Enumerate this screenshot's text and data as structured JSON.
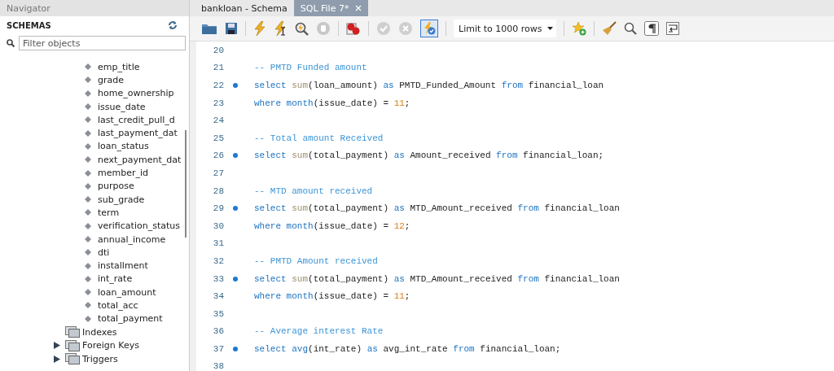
{
  "navigator": {
    "title": "Navigator",
    "section": "SCHEMAS",
    "filter": {
      "placeholder": "Filter objects"
    },
    "columns": [
      "emp_title",
      "grade",
      "home_ownership",
      "issue_date",
      "last_credit_pull_d",
      "last_payment_dat",
      "loan_status",
      "next_payment_dat",
      "member_id",
      "purpose",
      "sub_grade",
      "term",
      "verification_status",
      "annual_income",
      "dti",
      "installment",
      "int_rate",
      "loan_amount",
      "total_acc",
      "total_payment"
    ],
    "folders": [
      {
        "label": "Indexes"
      },
      {
        "label": "Foreign Keys",
        "expanded": false
      },
      {
        "label": "Triggers",
        "expanded": false
      }
    ]
  },
  "tabs": [
    {
      "label": "bankloan - Schema",
      "selected": false
    },
    {
      "label": "SQL File 7*",
      "selected": true
    }
  ],
  "toolbar": {
    "commit_disabled": true,
    "rollback_disabled": true,
    "autocommit_on": true,
    "limit": "Limit to 1000 rows"
  },
  "editor": {
    "lines": [
      {
        "number": "20",
        "marker": false
      },
      {
        "number": "21",
        "marker": false,
        "tokens": [
          {
            "kind": "comment",
            "text": "-- PMTD Funded amount"
          }
        ]
      },
      {
        "number": "22",
        "marker": true,
        "tokens": [
          {
            "kind": "keyword",
            "text": "select "
          },
          {
            "kind": "builtin",
            "text": "sum"
          },
          {
            "kind": "plain",
            "text": "(loan_amount) "
          },
          {
            "kind": "keyword",
            "text": "as"
          },
          {
            "kind": "plain",
            "text": " PMTD_Funded_Amount "
          },
          {
            "kind": "keyword",
            "text": "from"
          },
          {
            "kind": "plain",
            "text": " financial_loan"
          }
        ]
      },
      {
        "number": "23",
        "marker": false,
        "tokens": [
          {
            "kind": "keyword",
            "text": "where "
          },
          {
            "kind": "function",
            "text": "month"
          },
          {
            "kind": "plain",
            "text": "(issue_date) = "
          },
          {
            "kind": "number",
            "text": "11"
          },
          {
            "kind": "plain",
            "text": ";"
          }
        ]
      },
      {
        "number": "24",
        "marker": false
      },
      {
        "number": "25",
        "marker": false,
        "tokens": [
          {
            "kind": "comment",
            "text": "-- Total amount Received"
          }
        ]
      },
      {
        "number": "26",
        "marker": true,
        "tokens": [
          {
            "kind": "keyword",
            "text": "select "
          },
          {
            "kind": "builtin",
            "text": "sum"
          },
          {
            "kind": "plain",
            "text": "(total_payment) "
          },
          {
            "kind": "keyword",
            "text": "as"
          },
          {
            "kind": "plain",
            "text": " Amount_received "
          },
          {
            "kind": "keyword",
            "text": "from"
          },
          {
            "kind": "plain",
            "text": " financial_loan;"
          }
        ]
      },
      {
        "number": "27",
        "marker": false
      },
      {
        "number": "28",
        "marker": false,
        "tokens": [
          {
            "kind": "comment",
            "text": "-- MTD amount received"
          }
        ]
      },
      {
        "number": "29",
        "marker": true,
        "tokens": [
          {
            "kind": "keyword",
            "text": "select "
          },
          {
            "kind": "builtin",
            "text": "sum"
          },
          {
            "kind": "plain",
            "text": "(total_payment) "
          },
          {
            "kind": "keyword",
            "text": "as"
          },
          {
            "kind": "plain",
            "text": " MTD_Amount_received "
          },
          {
            "kind": "keyword",
            "text": "from"
          },
          {
            "kind": "plain",
            "text": " financial_loan"
          }
        ]
      },
      {
        "number": "30",
        "marker": false,
        "tokens": [
          {
            "kind": "keyword",
            "text": "where "
          },
          {
            "kind": "function",
            "text": "month"
          },
          {
            "kind": "plain",
            "text": "(issue_date) = "
          },
          {
            "kind": "number",
            "text": "12"
          },
          {
            "kind": "plain",
            "text": ";"
          }
        ]
      },
      {
        "number": "31",
        "marker": false
      },
      {
        "number": "32",
        "marker": false,
        "tokens": [
          {
            "kind": "comment",
            "text": "-- PMTD Amount received"
          }
        ]
      },
      {
        "number": "33",
        "marker": true,
        "tokens": [
          {
            "kind": "keyword",
            "text": "select "
          },
          {
            "kind": "builtin",
            "text": "sum"
          },
          {
            "kind": "plain",
            "text": "(total_payment) "
          },
          {
            "kind": "keyword",
            "text": "as"
          },
          {
            "kind": "plain",
            "text": " MTD_Amount_received "
          },
          {
            "kind": "keyword",
            "text": "from"
          },
          {
            "kind": "plain",
            "text": " financial_loan"
          }
        ]
      },
      {
        "number": "34",
        "marker": false,
        "tokens": [
          {
            "kind": "keyword",
            "text": "where "
          },
          {
            "kind": "function",
            "text": "month"
          },
          {
            "kind": "plain",
            "text": "(issue_date) = "
          },
          {
            "kind": "number",
            "text": "11"
          },
          {
            "kind": "plain",
            "text": ";"
          }
        ]
      },
      {
        "number": "35",
        "marker": false
      },
      {
        "number": "36",
        "marker": false,
        "tokens": [
          {
            "kind": "comment",
            "text": "-- Average interest Rate"
          }
        ]
      },
      {
        "number": "37",
        "marker": true,
        "tokens": [
          {
            "kind": "keyword",
            "text": "select "
          },
          {
            "kind": "function",
            "text": "avg"
          },
          {
            "kind": "plain",
            "text": "(int_rate) "
          },
          {
            "kind": "keyword",
            "text": "as"
          },
          {
            "kind": "plain",
            "text": " avg_int_rate "
          },
          {
            "kind": "keyword",
            "text": "from"
          },
          {
            "kind": "plain",
            "text": " financial_loan;"
          }
        ]
      },
      {
        "number": "38",
        "marker": false
      }
    ]
  }
}
